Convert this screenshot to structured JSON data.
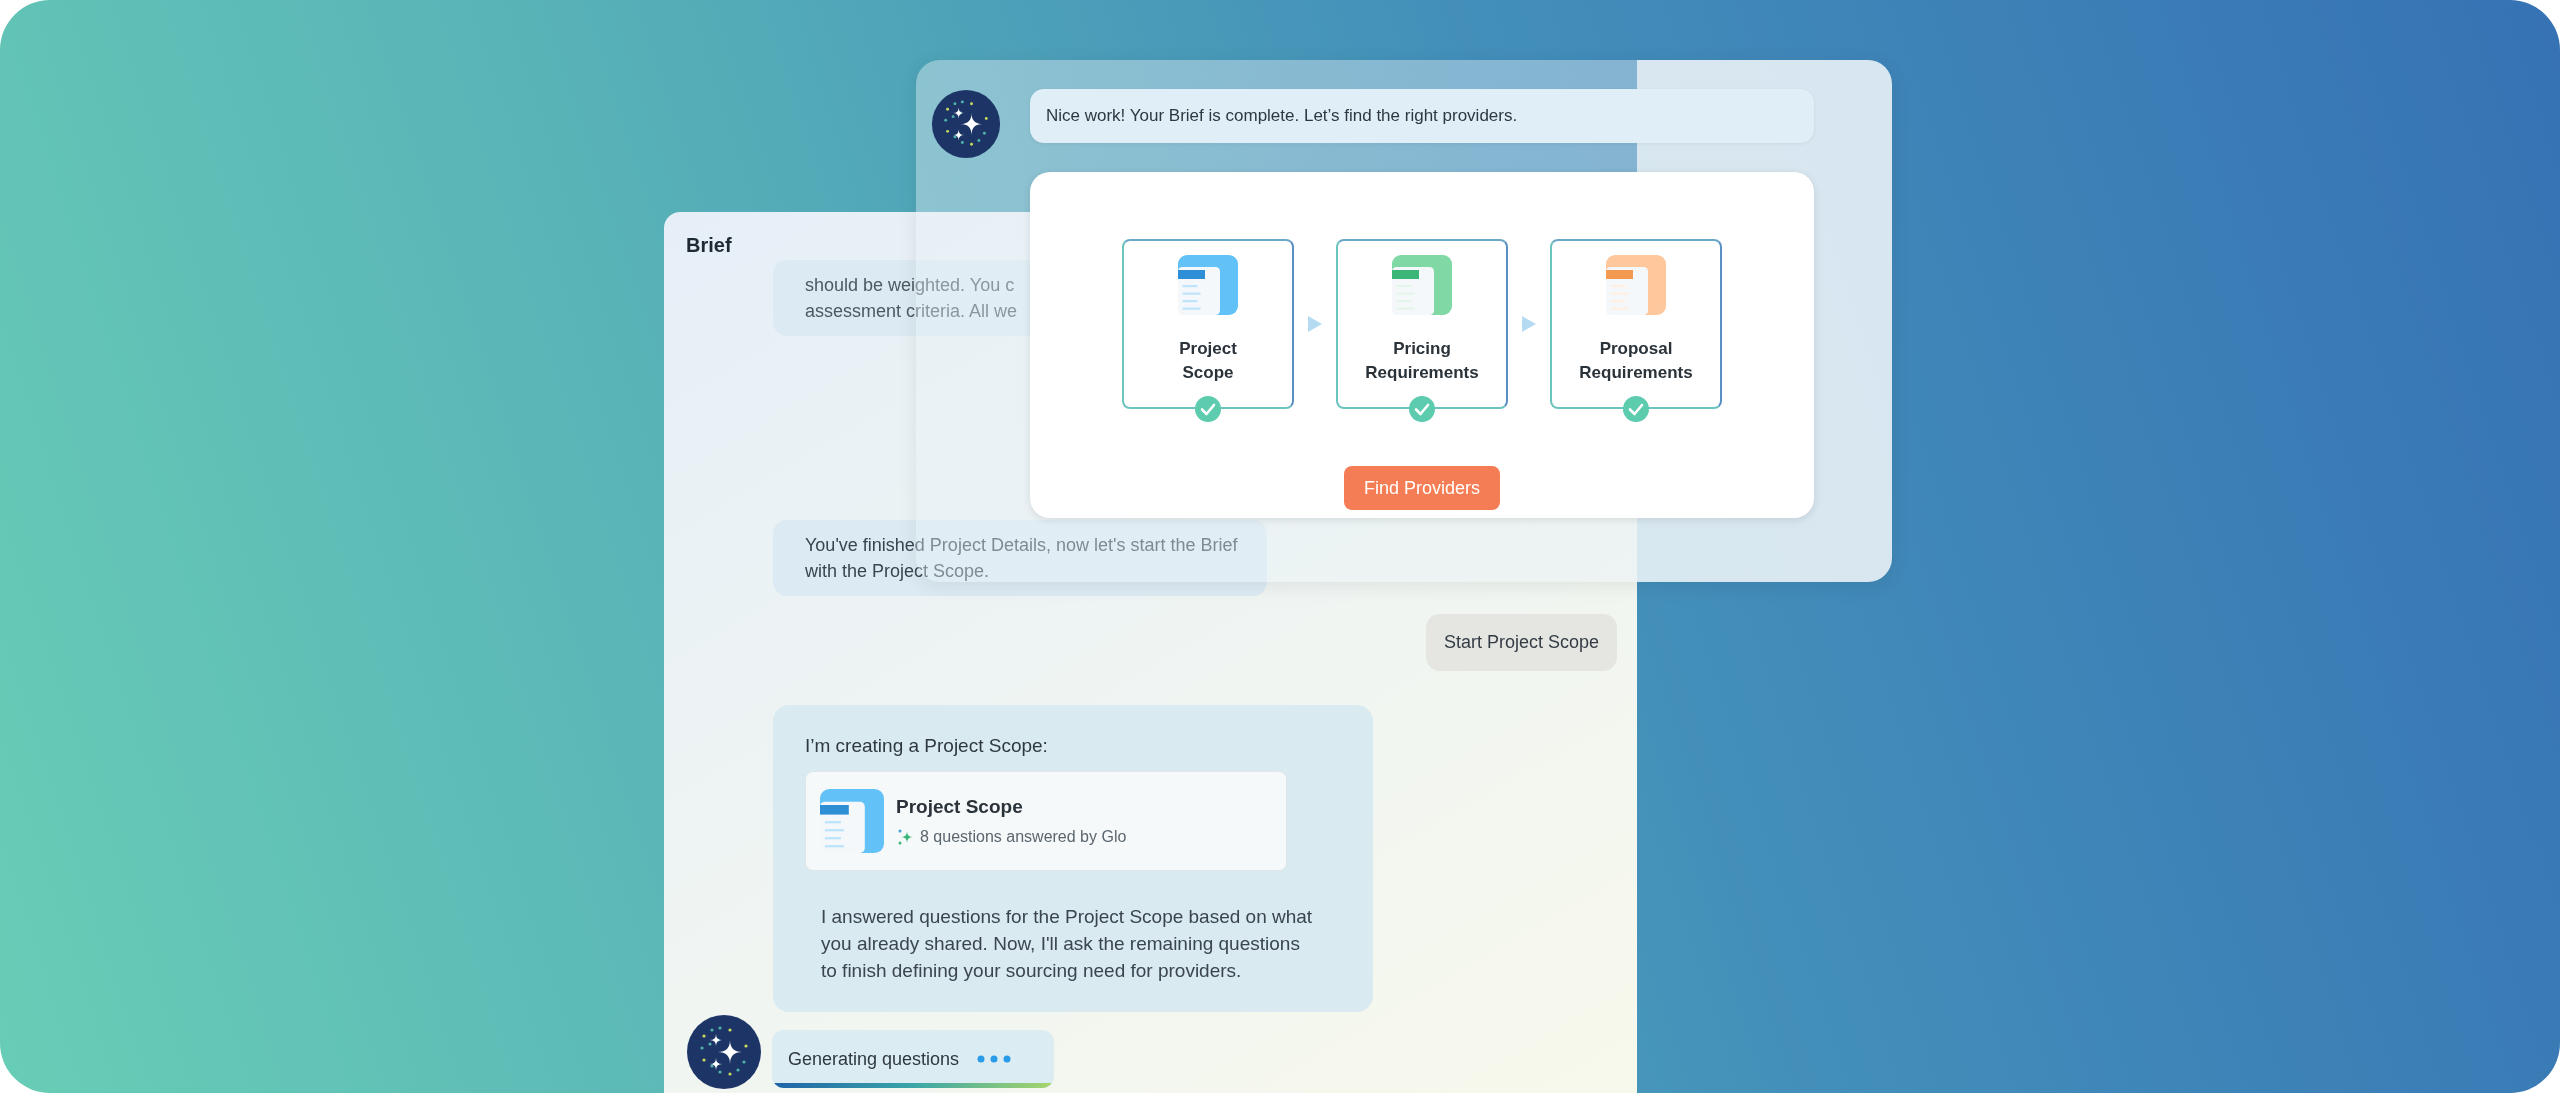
{
  "back_panel": {
    "title": "Brief",
    "messages": [
      {
        "kind": "bot",
        "lines": [
          "should be weighted. You c",
          "assessment criteria. All we"
        ]
      },
      {
        "kind": "bot",
        "lines": [
          "You've finished Project Details, now let's start the Brief",
          "with the Project Scope."
        ]
      },
      {
        "kind": "user",
        "text": "Start Project Scope"
      },
      {
        "kind": "creation",
        "intro": "I’m creating a Project Scope:",
        "doc_title": "Project Scope",
        "doc_meta": "8 questions answered by Glo",
        "lines": [
          "I answered questions for the Project Scope based on what",
          "you already shared. Now, I'll ask the remaining questions",
          "to finish defining your sourcing need for providers."
        ]
      },
      {
        "kind": "typing",
        "text": "Generating questions",
        "level": 1
      }
    ]
  },
  "front_panel": {
    "message": "Nice work! Your Brief is complete. Let’s find the right providers.",
    "steps": [
      {
        "kind": "scope",
        "lines": [
          "Project",
          "Scope"
        ],
        "completed": true
      },
      {
        "kind": "pricing",
        "lines": [
          "Pricing",
          "Requirements"
        ],
        "completed": true
      },
      {
        "kind": "proposal",
        "lines": [
          "Proposal",
          "Requirements"
        ],
        "completed": true
      }
    ],
    "button": "Find Providers"
  }
}
